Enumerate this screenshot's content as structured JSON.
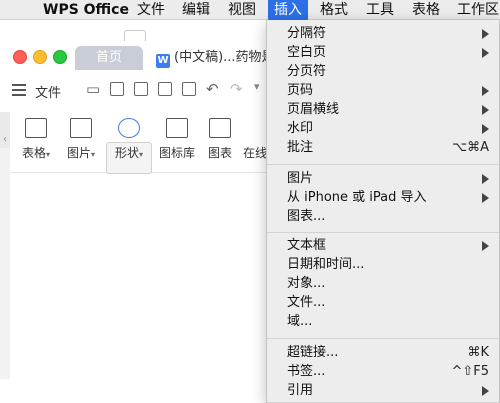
{
  "menubar": {
    "app_name": "WPS Office",
    "items": [
      "文件",
      "编辑",
      "视图",
      "插入",
      "格式",
      "工具",
      "表格",
      "工作区"
    ],
    "active_index": 3
  },
  "window": {
    "tabs": [
      {
        "label": "首页"
      },
      {
        "label": "(中文稿)...药物是"
      }
    ],
    "toolbar": {
      "file_label": "文件"
    },
    "ribbon": [
      {
        "label": "表格"
      },
      {
        "label": "图片"
      },
      {
        "label": "形状"
      },
      {
        "label": "图标库"
      },
      {
        "label": "图表"
      },
      {
        "label": "在线"
      }
    ]
  },
  "insert_menu": {
    "groups": [
      [
        {
          "label": "分隔符",
          "submenu": true
        },
        {
          "label": "空白页",
          "submenu": true
        },
        {
          "label": "分页符",
          "submenu": false
        },
        {
          "label": "页码",
          "submenu": true
        },
        {
          "label": "页眉横线",
          "submenu": true
        },
        {
          "label": "水印",
          "submenu": true
        },
        {
          "label": "批注",
          "shortcut": "⌥⌘A"
        }
      ],
      [
        {
          "label": "图片",
          "submenu": true
        },
        {
          "label": "从 iPhone 或 iPad 导入",
          "submenu": true
        },
        {
          "label": "图表...",
          "submenu": false
        }
      ],
      [
        {
          "label": "文本框",
          "submenu": true
        },
        {
          "label": "日期和时间...",
          "submenu": false
        },
        {
          "label": "对象...",
          "submenu": false
        },
        {
          "label": "文件...",
          "submenu": false
        },
        {
          "label": "域...",
          "submenu": false
        }
      ],
      [
        {
          "label": "超链接...",
          "shortcut": "⌘K"
        },
        {
          "label": "书签...",
          "shortcut": "^⇧F5"
        },
        {
          "label": "引用",
          "submenu": true
        }
      ]
    ]
  },
  "colors": {
    "menu_highlight": "#2d6fe6",
    "menu_bg": "#ededed",
    "tab_home_bg": "#c9ced6"
  }
}
